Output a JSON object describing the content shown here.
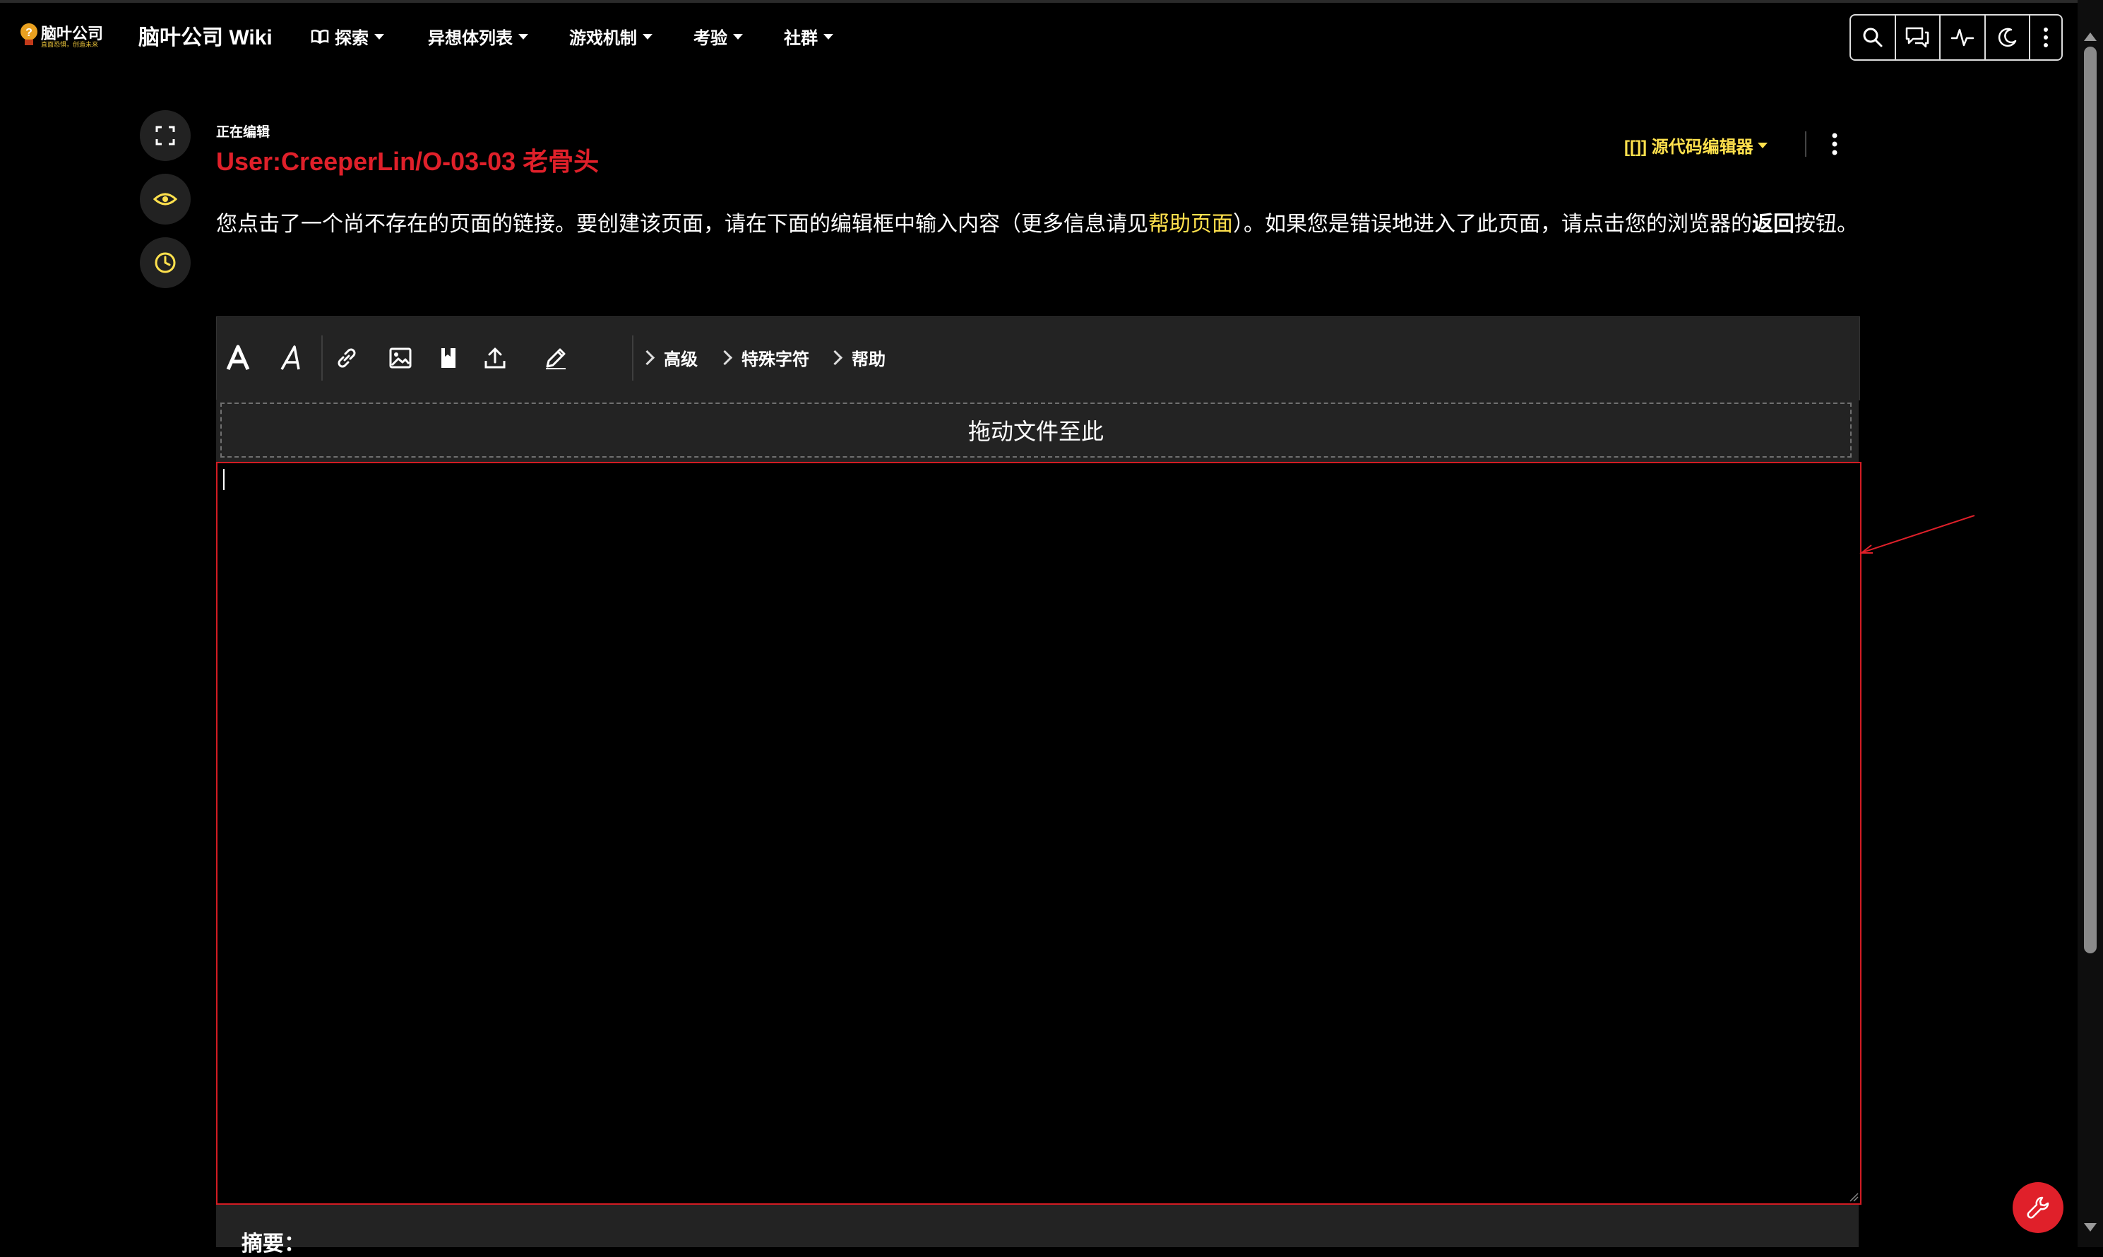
{
  "header": {
    "logo_text": "脑叶公司",
    "logo_subtext": "直面恐惧，创造未来",
    "site_title": "脑叶公司 Wiki",
    "nav": [
      {
        "label": "探索",
        "icon": "book-open-icon"
      },
      {
        "label": "异想体列表"
      },
      {
        "label": "游戏机制"
      },
      {
        "label": "考验"
      },
      {
        "label": "社群"
      }
    ],
    "tools": [
      "search-icon",
      "talk-icon",
      "activity-icon",
      "theme-moon-icon",
      "more-vertical-icon"
    ]
  },
  "editor": {
    "status_label": "正在编辑",
    "page_title": "User:CreeperLin/O-03-03 老骨头",
    "mode_label": "[[]] 源代码编辑器",
    "notice_before": "您点击了一个尚不存在的页面的链接。要创建该页面，请在下面的编辑框中输入内容（更多信息请见",
    "notice_link": "帮助页面",
    "notice_after": "）。如果您是错误地进入了此页面，请点击您的浏览器的",
    "notice_bold": "返回",
    "notice_end": "按钮。",
    "toolbar_groups": [
      "高级",
      "特殊字符",
      "帮助"
    ],
    "dropzone_text": "拖动文件至此",
    "textarea_value": "",
    "summary_label": "摘要："
  },
  "colors": {
    "accent_red": "#e0202a",
    "accent_yellow": "#ffe14d",
    "background": "#000000",
    "panel": "#232323"
  }
}
